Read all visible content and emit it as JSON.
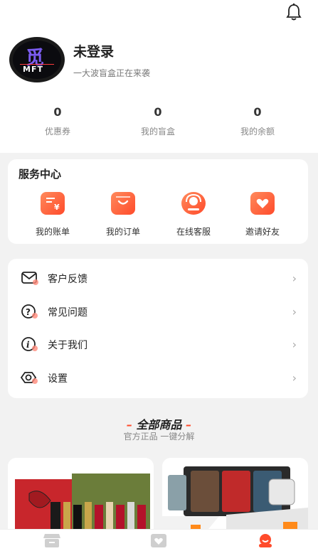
{
  "header": {
    "bell_icon": "bell-icon"
  },
  "profile": {
    "name": "未登录",
    "subtitle": "一大波盲盒正在来袭",
    "avatar_text": "MFT",
    "avatar_glyph": "觅"
  },
  "stats": [
    {
      "value": "0",
      "label": "优惠券"
    },
    {
      "value": "0",
      "label": "我的盲盒"
    },
    {
      "value": "0",
      "label": "我的余额"
    }
  ],
  "service": {
    "title": "服务中心",
    "items": [
      {
        "label": "我的账单",
        "icon": "bill-icon"
      },
      {
        "label": "我的订单",
        "icon": "order-icon"
      },
      {
        "label": "在线客服",
        "icon": "customer-service-icon"
      },
      {
        "label": "邀请好友",
        "icon": "invite-icon"
      }
    ]
  },
  "menu": {
    "items": [
      {
        "label": "客户反馈",
        "icon": "mail-icon"
      },
      {
        "label": "常见问题",
        "icon": "question-icon"
      },
      {
        "label": "关于我们",
        "icon": "info-icon"
      },
      {
        "label": "设置",
        "icon": "settings-icon"
      }
    ],
    "chevron": "›"
  },
  "section": {
    "title": "全部商品",
    "subtitle": "官方正品 一键分解"
  },
  "products": [
    {
      "name": "cosmetics-gift-set",
      "image": "lipstick-box-image"
    },
    {
      "name": "electronics-bundle",
      "image": "phones-tablets-image"
    }
  ],
  "tabbar": {
    "tabs": [
      {
        "icon": "store-icon"
      },
      {
        "icon": "box-icon"
      },
      {
        "icon": "profile-icon"
      }
    ],
    "accent": "#ff4b2b"
  },
  "colors": {
    "accent": "#ff4b2b",
    "background": "#f2f2f2"
  }
}
